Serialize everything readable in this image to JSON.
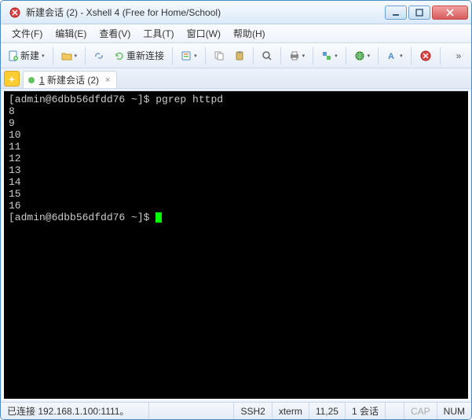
{
  "window": {
    "title": "新建会话 (2) - Xshell 4 (Free for Home/School)"
  },
  "menubar": {
    "items": [
      "文件(F)",
      "编辑(E)",
      "查看(V)",
      "工具(T)",
      "窗口(W)",
      "帮助(H)"
    ]
  },
  "toolbar": {
    "new_label": "新建",
    "reconnect_label": "重新连接"
  },
  "tabs": {
    "active": {
      "number": "1",
      "title": "新建会话 (2)"
    }
  },
  "terminal": {
    "lines": [
      "[admin@6dbb56dfdd76 ~]$ pgrep httpd",
      "8",
      "9",
      "10",
      "11",
      "12",
      "13",
      "14",
      "15",
      "16",
      "[admin@6dbb56dfdd76 ~]$ "
    ]
  },
  "statusbar": {
    "connection": "已连接 192.168.1.100:1111。",
    "protocol": "SSH2",
    "termtype": "xterm",
    "cursor": "11,25",
    "sessions": "1 会话",
    "cap": "CAP",
    "num": "NUM"
  }
}
